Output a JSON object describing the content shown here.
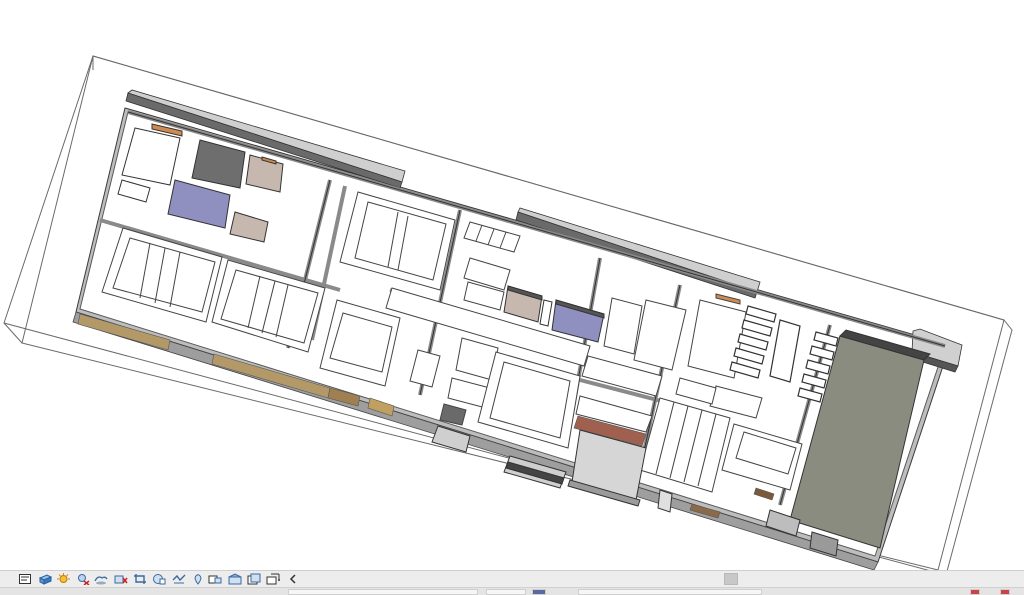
{
  "viewport": {
    "content": "3d-building-model",
    "colors": {
      "background": "#ffffff",
      "site_outline": "#606060",
      "floor_fill": "#ffffff",
      "wall_fill": "#d2d2d2",
      "wall_top": "#9a9a9a",
      "wall_dark": "#555555",
      "plant_room": "#8a8c80",
      "accent_blue": "#9090c0",
      "accent_beige": "#c6b8ae",
      "accent_dark": "#747474",
      "facade_wood": "#b39968",
      "fixture_orange": "#d08a50"
    }
  },
  "view_control_bar": {
    "background": "#ededed",
    "buttons": [
      {
        "name": "scale-icon"
      },
      {
        "name": "detail-level-icon"
      },
      {
        "name": "visual-style-icon"
      },
      {
        "name": "sun-path-off-icon"
      },
      {
        "name": "shadows-icon"
      },
      {
        "name": "show-rendering-dialog-icon"
      },
      {
        "name": "crop-view-icon"
      },
      {
        "name": "show-crop-region-icon"
      },
      {
        "name": "unlocked-3d-view-icon"
      },
      {
        "name": "temporary-hide-isolate-icon"
      },
      {
        "name": "reveal-hidden-elements-icon"
      },
      {
        "name": "temporary-view-properties-icon"
      },
      {
        "name": "show-analytical-model-icon"
      },
      {
        "name": "highlight-displacement-icon"
      },
      {
        "name": "reveal-constraints-icon"
      },
      {
        "name": "collapse-arrow-icon"
      }
    ]
  }
}
